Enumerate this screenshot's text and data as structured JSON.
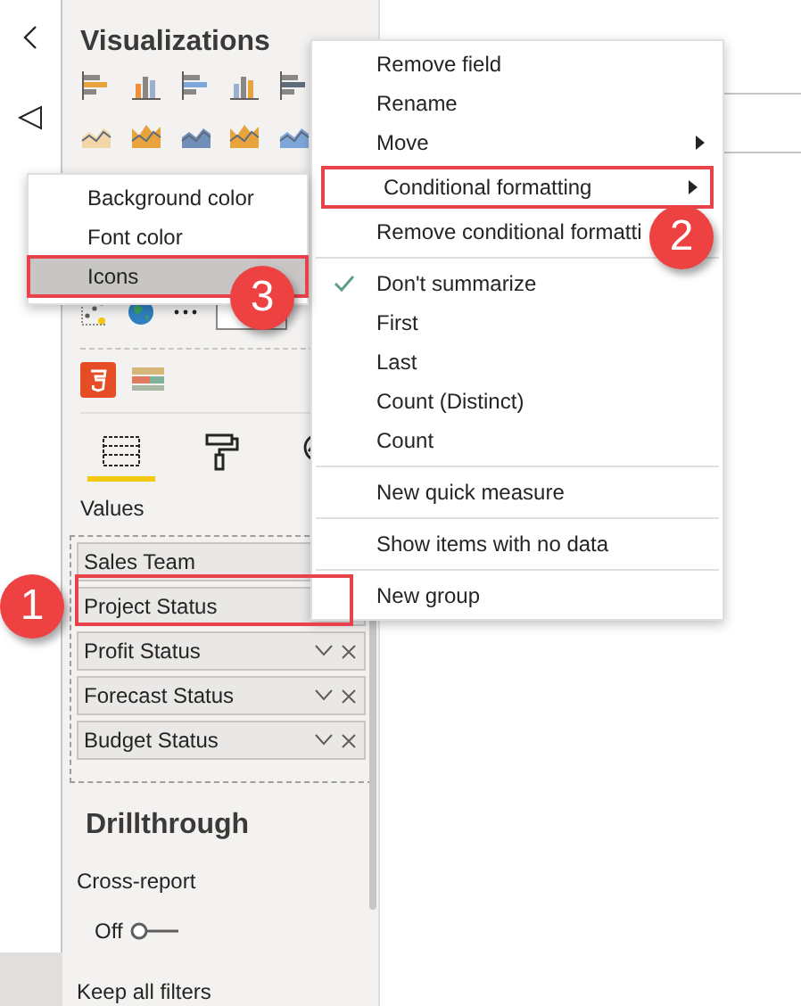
{
  "visualizations": {
    "title": "Visualizations",
    "tabs": [
      {
        "kind": "fields",
        "selected": true
      },
      {
        "kind": "format",
        "selected": false
      },
      {
        "kind": "analytics",
        "selected": false
      }
    ],
    "values_label": "Values",
    "fields": [
      {
        "kind": "partial",
        "name": "Sales Team"
      },
      {
        "kind": "partial",
        "name": "Project Status"
      },
      {
        "kind": "full",
        "name": "Profit Status"
      },
      {
        "kind": "full",
        "name": "Forecast Status"
      },
      {
        "kind": "full",
        "name": "Budget Status"
      }
    ],
    "drillthrough": {
      "title": "Drillthrough",
      "cross_report": {
        "label": "Cross-report",
        "state": "Off",
        "on": false
      },
      "keep_all_filters": "Keep all filters"
    }
  },
  "context_menu": {
    "items": [
      {
        "kind": "item",
        "label": "Remove field",
        "submenu": false,
        "checked": false,
        "highlighted": false
      },
      {
        "kind": "item",
        "label": "Rename",
        "submenu": false,
        "checked": false,
        "highlighted": false
      },
      {
        "kind": "item",
        "label": "Move",
        "submenu": true,
        "checked": false,
        "highlighted": false
      },
      {
        "kind": "item",
        "label": "Conditional formatting",
        "submenu": true,
        "checked": false,
        "highlighted": true
      },
      {
        "kind": "item",
        "label": "Remove conditional formatti",
        "submenu": false,
        "checked": false,
        "highlighted": false
      },
      {
        "kind": "divider"
      },
      {
        "kind": "item",
        "label": "Don't summarize",
        "submenu": false,
        "checked": true,
        "highlighted": false
      },
      {
        "kind": "item",
        "label": "First",
        "submenu": false,
        "checked": false,
        "highlighted": false
      },
      {
        "kind": "item",
        "label": "Last",
        "submenu": false,
        "checked": false,
        "highlighted": false
      },
      {
        "kind": "item",
        "label": "Count (Distinct)",
        "submenu": false,
        "checked": false,
        "highlighted": false
      },
      {
        "kind": "item",
        "label": "Count",
        "submenu": false,
        "checked": false,
        "highlighted": false
      },
      {
        "kind": "divider"
      },
      {
        "kind": "item",
        "label": "New quick measure",
        "submenu": false,
        "checked": false,
        "highlighted": false
      },
      {
        "kind": "divider"
      },
      {
        "kind": "item",
        "label": "Show items with no data",
        "submenu": false,
        "checked": false,
        "highlighted": false
      },
      {
        "kind": "divider"
      },
      {
        "kind": "item",
        "label": "New group",
        "submenu": false,
        "checked": false,
        "highlighted": false
      }
    ]
  },
  "submenu": {
    "items": [
      {
        "label": "Background color",
        "selected": false
      },
      {
        "label": "Font color",
        "selected": false
      },
      {
        "label": "Icons",
        "selected": true
      }
    ]
  },
  "callouts": [
    {
      "number": "1"
    },
    {
      "number": "2"
    },
    {
      "number": "3"
    }
  ]
}
